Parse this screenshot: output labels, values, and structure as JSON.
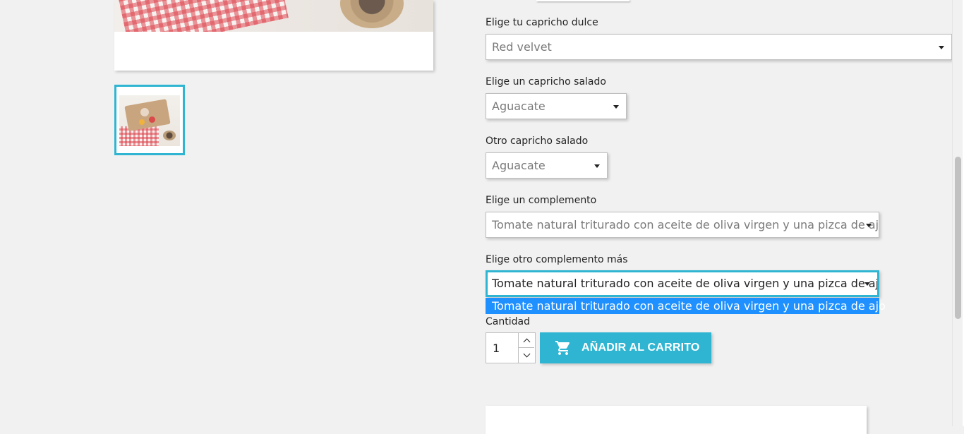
{
  "gallery": {
    "main_image_icon": "product-photo",
    "thumbnail_icon": "product-thumbnail"
  },
  "options": [
    {
      "label": "Elige tu capricho dulce",
      "value": "Red velvet"
    },
    {
      "label": "Elige un capricho salado",
      "value": "Aguacate"
    },
    {
      "label": "Otro capricho salado",
      "value": "Aguacate"
    },
    {
      "label": "Elige un complemento",
      "value": "Tomate natural triturado con aceite de oliva virgen y una pizca de ajo"
    },
    {
      "label": "Elige otro complemento más",
      "value": "Tomate natural triturado con aceite de oliva virgen y una pizca de ajo"
    }
  ],
  "dropdown": {
    "open_for": "Elige otro complemento más",
    "highlighted_option": "Tomate natural triturado con aceite de oliva virgen y una pizca de ajo"
  },
  "quantity": {
    "label": "Cantidad",
    "value": "1"
  },
  "cart_button": {
    "label": "AÑADIR AL CARRITO",
    "icon": "shopping-cart-icon"
  },
  "colors": {
    "accent": "#2fb5d2",
    "dropdown_highlight": "#1e90ff",
    "background": "#f1f1f1"
  }
}
